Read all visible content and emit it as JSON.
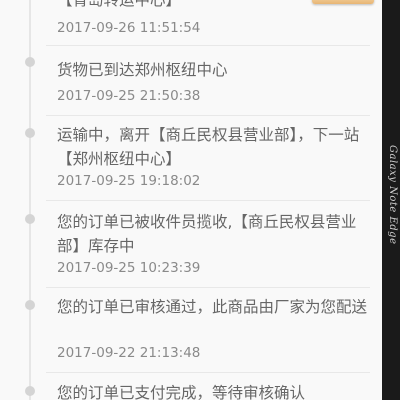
{
  "tracking": {
    "entries": [
      {
        "message": "【青岛转运中心】",
        "time": "2017-09-26 11:51:54"
      },
      {
        "message": "货物已到达郑州枢纽中心",
        "time": "2017-09-25 21:50:38"
      },
      {
        "message": "运输中，离开【商丘民权县营业部】，下一站【郑州枢纽中心】",
        "time": "2017-09-25 19:18:02"
      },
      {
        "message": "您的订单已被收件员揽收,【商丘民权县营业部】库存中",
        "time": "2017-09-25 10:23:39"
      },
      {
        "message": "您的订单已审核通过，此商品由厂家为您配送",
        "time": "2017-09-22 21:13:48"
      },
      {
        "message": "您的订单已支付完成，等待审核确认",
        "time": ""
      }
    ]
  },
  "edge_panel": {
    "label": "Galaxy Note Edge"
  }
}
